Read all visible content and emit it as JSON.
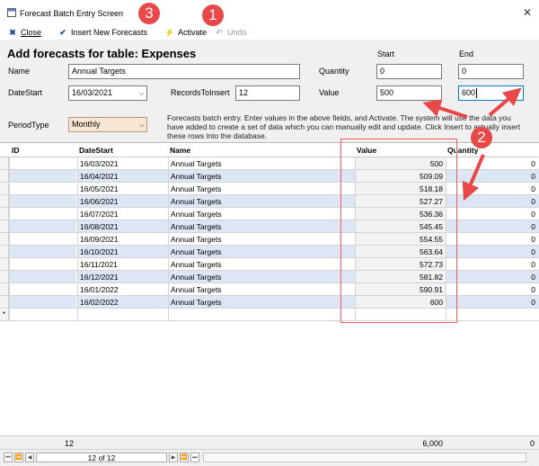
{
  "window": {
    "title": "Forecast Batch Entry Screen",
    "close_glyph": "✕"
  },
  "toolbar": {
    "close_label": "Close",
    "insert_label": "Insert New Forecasts",
    "activate_label": "Activate",
    "undo_label": "Undo"
  },
  "form": {
    "heading": "Add forecasts for table: Expenses",
    "name_label": "Name",
    "name_value": "Annual Targets",
    "datestart_label": "DateStart",
    "datestart_value": "16/03/2021",
    "records_label": "RecordsToInsert",
    "records_value": "12",
    "periodtype_label": "PeriodType",
    "periodtype_value": "Monthly",
    "start_label": "Start",
    "end_label": "End",
    "quantity_label": "Quantity",
    "quantity_start": "0",
    "quantity_end": "0",
    "value_label": "Value",
    "value_start": "500",
    "value_end": "600",
    "description": "Forecasts batch entry. Enter values in the above fields, and Activate. The system will use the data you have added to create a set of data which you can manually edit and update. Click Insert to actually insert these rows into the database."
  },
  "grid": {
    "columns": [
      "ID",
      "DateStart",
      "Name",
      "Value",
      "Quantity"
    ],
    "rows": [
      {
        "id": "",
        "date": "16/03/2021",
        "name": "Annual Targets",
        "value": "500",
        "quantity": "0"
      },
      {
        "id": "",
        "date": "16/04/2021",
        "name": "Annual Targets",
        "value": "509.09",
        "quantity": "0"
      },
      {
        "id": "",
        "date": "16/05/2021",
        "name": "Annual Targets",
        "value": "518.18",
        "quantity": "0"
      },
      {
        "id": "",
        "date": "16/06/2021",
        "name": "Annual Targets",
        "value": "527.27",
        "quantity": "0"
      },
      {
        "id": "",
        "date": "16/07/2021",
        "name": "Annual Targets",
        "value": "536.36",
        "quantity": "0"
      },
      {
        "id": "",
        "date": "16/08/2021",
        "name": "Annual Targets",
        "value": "545.45",
        "quantity": "0"
      },
      {
        "id": "",
        "date": "16/09/2021",
        "name": "Annual Targets",
        "value": "554.55",
        "quantity": "0"
      },
      {
        "id": "",
        "date": "16/10/2021",
        "name": "Annual Targets",
        "value": "563.64",
        "quantity": "0"
      },
      {
        "id": "",
        "date": "16/11/2021",
        "name": "Annual Targets",
        "value": "572.73",
        "quantity": "0"
      },
      {
        "id": "",
        "date": "16/12/2021",
        "name": "Annual Targets",
        "value": "581.82",
        "quantity": "0"
      },
      {
        "id": "",
        "date": "16/01/2022",
        "name": "Annual Targets",
        "value": "590.91",
        "quantity": "0"
      },
      {
        "id": "",
        "date": "16/02/2022",
        "name": "Annual Targets",
        "value": "600",
        "quantity": "0"
      }
    ],
    "new_row_marker": "*"
  },
  "footer": {
    "count": "12",
    "value_total": "6,000",
    "quantity_total": "0"
  },
  "navigation": {
    "record_status": "12 of 12"
  },
  "annotations": {
    "badge_1": "1",
    "badge_2": "2",
    "badge_3": "3"
  },
  "colors": {
    "row_highlight": "#dce6f4",
    "annotation_red": "#e84848",
    "period_bg": "#f6e6d2",
    "form_bg": "#f0f0f0"
  }
}
